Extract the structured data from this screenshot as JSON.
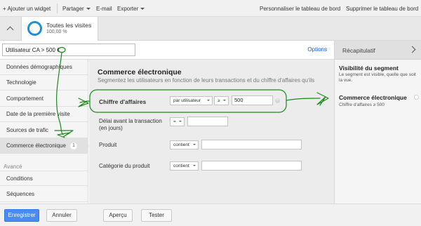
{
  "toolbar": {
    "add_widget": "+ Ajouter un widget",
    "share": "Partager",
    "email": "E-mail",
    "export": "Exporter",
    "customize": "Personnaliser le tableau de bord",
    "delete": "Supprimer le tableau de bord"
  },
  "segment_card": {
    "title": "Toutes les visites",
    "subtitle": "100,00 %",
    "ring_color": "#1a8fe0"
  },
  "segment_name": {
    "value": "Utilisateur CA > 500 €",
    "options": "Options"
  },
  "nav": {
    "items": [
      {
        "label": "Données démographiques"
      },
      {
        "label": "Technologie"
      },
      {
        "label": "Comportement"
      },
      {
        "label": "Date de la première visite"
      },
      {
        "label": "Sources de trafic"
      },
      {
        "label": "Commerce électronique",
        "badge": "1"
      }
    ],
    "advanced_heading": "Avancé",
    "advanced_items": [
      {
        "label": "Conditions"
      },
      {
        "label": "Séquences"
      }
    ]
  },
  "main": {
    "title": "Commerce électronique",
    "description": "Segmentez les utilisateurs en fonction de leurs transactions et du chiffre d'affaires qu'ils",
    "rows": {
      "revenue": {
        "label": "Chiffre d'affaires",
        "scope": "par utilisateur",
        "operator": "≥",
        "value": "500"
      },
      "days": {
        "label": "Délai avant la transaction (en jours)",
        "operator": "=",
        "value": ""
      },
      "product": {
        "label": "Produit",
        "operator": "contient",
        "value": ""
      },
      "category": {
        "label": "Catégorie du produit",
        "operator": "contient",
        "value": ""
      }
    }
  },
  "summary": {
    "header": "Récapitulatif",
    "visibility_title": "Visibilité du segment",
    "visibility_text_1": "Le segment est visible, quelle que soit",
    "visibility_text_2": "la vue.",
    "ecommerce_title": "Commerce électronique",
    "ecommerce_condition": "Chiffre d'affaires ≥ 500"
  },
  "footer": {
    "save": "Enregistrer",
    "cancel": "Annuler",
    "preview": "Aperçu",
    "test": "Tester"
  },
  "colors": {
    "accent": "#15c",
    "primary_button": "#4a8af4",
    "annotation": "#1a8a1a"
  }
}
